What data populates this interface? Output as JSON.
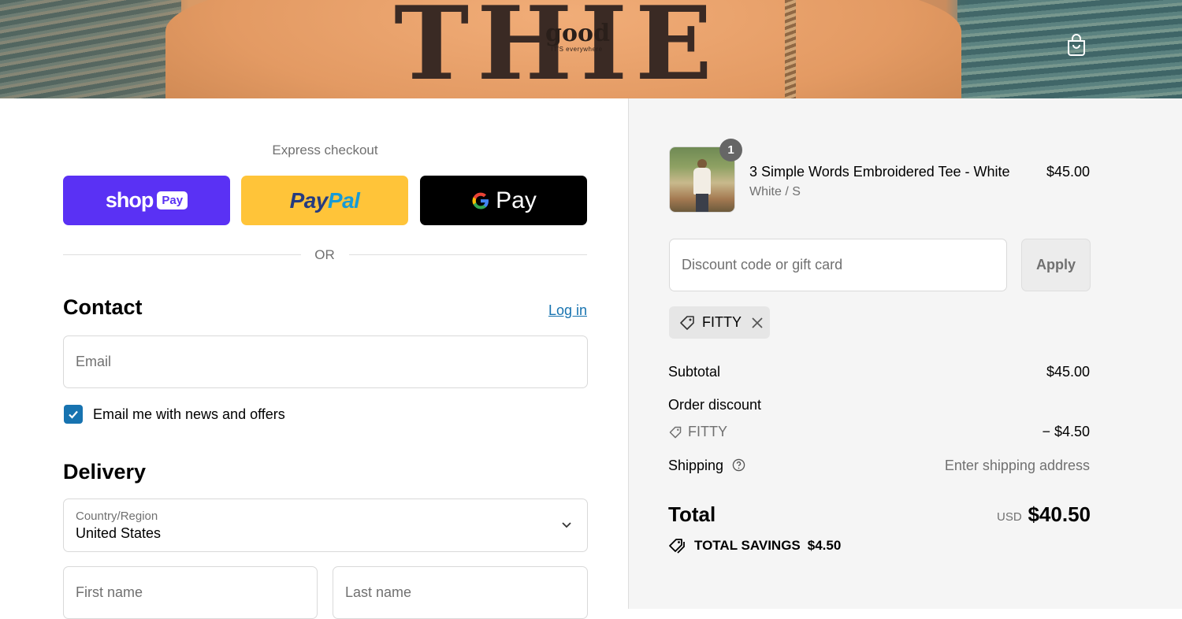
{
  "hero": {
    "shirt_text": "THIE",
    "logo_word": "good",
    "logo_sub": "IT'S everywhere"
  },
  "express": {
    "label": "Express checkout",
    "shop_word": "shop",
    "shop_pay": "Pay",
    "paypal_a": "Pay",
    "paypal_b": "Pal",
    "gpay_word": "Pay",
    "or_text": "OR"
  },
  "contact": {
    "heading": "Contact",
    "login_label": "Log in",
    "email_placeholder": "Email",
    "newsletter_label": "Email me with news and offers",
    "newsletter_checked": true
  },
  "delivery": {
    "heading": "Delivery",
    "country_label": "Country/Region",
    "country_value": "United States",
    "first_name_placeholder": "First name",
    "last_name_placeholder": "Last name"
  },
  "summary": {
    "product": {
      "title": "3 Simple Words Embroidered Tee - White",
      "variant": "White / S",
      "price": "$45.00",
      "quantity": "1"
    },
    "discount_placeholder": "Discount code or gift card",
    "apply_label": "Apply",
    "applied_code": "FITTY",
    "subtotal_label": "Subtotal",
    "subtotal_value": "$45.00",
    "order_discount_label": "Order discount",
    "discount_code": "FITTY",
    "discount_value": "− $4.50",
    "shipping_label": "Shipping",
    "shipping_value": "Enter shipping address",
    "total_label": "Total",
    "total_currency": "USD",
    "total_value": "$40.50",
    "savings_label": "TOTAL SAVINGS",
    "savings_value": "$4.50"
  },
  "colors": {
    "shop_pay": "#5a31f4",
    "paypal": "#ffc439",
    "gpay": "#000000",
    "link": "#1773b0",
    "summary_bg": "#f5f5f5"
  }
}
